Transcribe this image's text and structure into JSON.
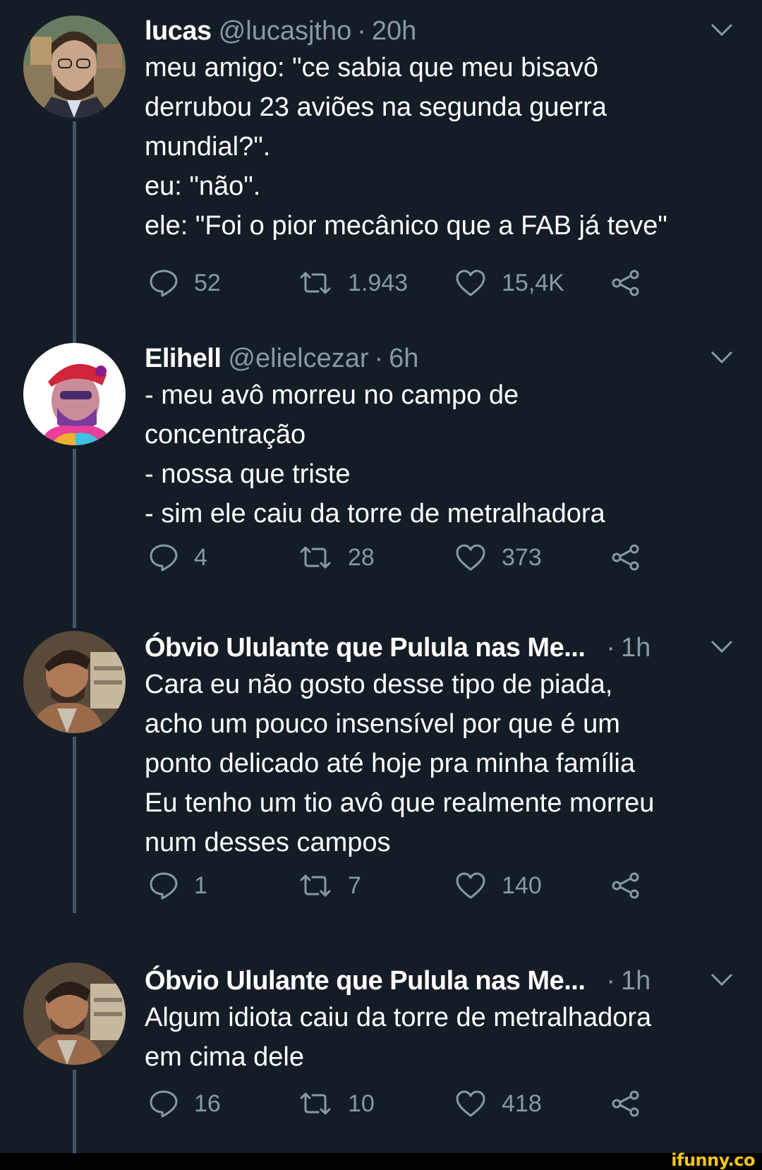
{
  "colors": {
    "background": "#141d26",
    "text": "#ffffff",
    "muted": "#8899a6",
    "thread_line": "#42566b",
    "watermark": "#f5c518"
  },
  "tweets": [
    {
      "name": "lucas",
      "handle": "@lucasjtho",
      "separator": "·",
      "time": "20h",
      "lines": [
        "meu amigo: \"ce sabia que meu bisavô",
        "derrubou 23 aviões na segunda guerra",
        "mundial?\".",
        "eu: \"não\".",
        "ele: \"Foi o pior mecânico que a FAB já teve\""
      ],
      "replies": "52",
      "retweets": "1.943",
      "likes": "15,4K",
      "icons": {
        "reply": "reply-icon",
        "retweet": "retweet-icon",
        "like": "heart-icon",
        "share": "share-icon",
        "menu": "chevron-down-icon"
      }
    },
    {
      "name": "Elihell",
      "handle": "@elielcezar",
      "separator": "·",
      "time": "6h",
      "lines": [
        "- meu avô morreu no campo de",
        "concentração",
        "- nossa que triste",
        "- sim ele caiu da torre de metralhadora"
      ],
      "replies": "4",
      "retweets": "28",
      "likes": "373"
    },
    {
      "name": "Óbvio Ululante que Pulula nas Me...",
      "handle": "",
      "separator": "·",
      "time": "1h",
      "lines": [
        "Cara eu não gosto desse tipo de piada,",
        "acho um pouco insensível por que é um",
        "ponto delicado até hoje pra minha família",
        "Eu tenho um tio avô que realmente morreu",
        "num desses campos"
      ],
      "replies": "1",
      "retweets": "7",
      "likes": "140"
    },
    {
      "name": "Óbvio Ululante que Pulula nas Me...",
      "handle": "",
      "separator": "·",
      "time": "1h",
      "lines": [
        "Algum idiota caiu da torre de metralhadora",
        "em cima dele"
      ],
      "replies": "16",
      "retweets": "10",
      "likes": "418"
    }
  ],
  "watermark": "ifunny.co"
}
